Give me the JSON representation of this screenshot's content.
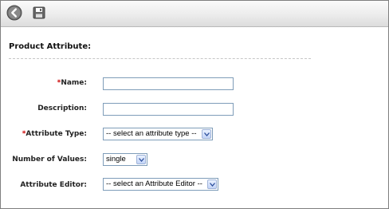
{
  "toolbar": {
    "back_icon": "back-arrow-icon",
    "save_icon": "floppy-disk-icon"
  },
  "form": {
    "section_title": "Product Attribute:",
    "required_marker": "*",
    "name_label": "Name:",
    "name_value": "",
    "description_label": "Description:",
    "description_value": "",
    "attribute_type_label": "Attribute Type:",
    "attribute_type_selected": "-- select an attribute type --",
    "number_of_values_label": "Number of Values:",
    "number_of_values_selected": "single",
    "attribute_editor_label": "Attribute Editor:",
    "attribute_editor_selected": "-- select an Attribute Editor --"
  },
  "colors": {
    "required": "#cc0000",
    "input_border": "#7f9db9"
  }
}
